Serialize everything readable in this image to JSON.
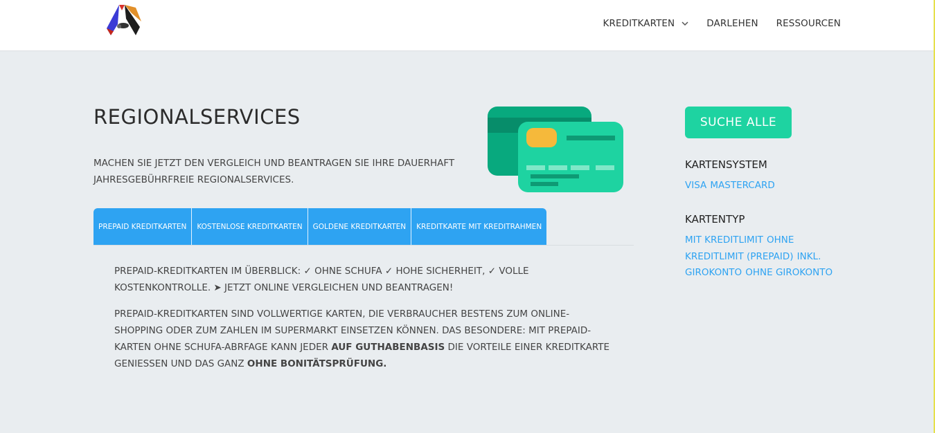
{
  "header": {
    "logo_name": "site-logo",
    "nav": [
      {
        "label": "KREDITKARTEN",
        "has_dropdown": true
      },
      {
        "label": "DARLEHEN",
        "has_dropdown": false
      },
      {
        "label": "RESSOURCEN",
        "has_dropdown": false
      }
    ]
  },
  "main": {
    "title": "REGIONALSERVICES",
    "subtitle": "MACHEN SIE JETZT DEN VERGLEICH UND BEANTRAGEN SIE IHRE DAUERHAFT JAHRESGEBÜHRFREIE REGIONALSERVICES.",
    "tabs": [
      {
        "label": "PREPAID KREDITKARTEN"
      },
      {
        "label": "KOSTENLOSE KREDITKARTEN"
      },
      {
        "label": "GOLDENE KREDITKARTEN"
      },
      {
        "label": "KREDITKARTE MIT KREDITRAHMEN"
      }
    ],
    "paragraph1": "PREPAID-KREDITKARTEN IM ÜBERBLICK: ✓ OHNE SCHUFA ✓ HOHE SICHERHEIT, ✓ VOLLE KOSTENKONTROLLE. ➤ JETZT ONLINE VERGLEICHEN UND BEANTRAGEN!",
    "paragraph2": {
      "part1": "PREPAID-KREDITKARTEN SIND VOLLWERTIGE KARTEN, DIE VERBRAUCHER BESTENS ZUM ONLINE-SHOPPING ODER ZUM ZAHLEN IM SUPERMARKT EINSETZEN KÖNNEN. DAS BESONDERE: MIT PREPAID-KARTEN OHNE SCHUFA-ABRFAGE KANN JEDER ",
      "bold1": "AUF GUTHABENBASIS",
      "part2": " DIE VORTEILE EINER KREDITKARTE GENIESSEN UND DAS GANZ ",
      "bold2": "OHNE BONITÄTSPRÜFUNG."
    }
  },
  "sidebar": {
    "search_label": "SUCHE ALLE",
    "kartensystem_heading": "KARTENSYSTEM",
    "kartensystem_links": [
      "VISA",
      "MASTERCARD"
    ],
    "kartentyp_heading": "KARTENTYP",
    "kartentyp_links": [
      "MIT KREDITLIMIT",
      "OHNE KREDITLIMIT (PREPAID)",
      "INKL. GIROKONTO",
      "OHNE GIROKONTO"
    ]
  },
  "colors": {
    "accent_blue": "#2ea3f2",
    "accent_green": "#1ed3a1",
    "background": "#e9edf0"
  }
}
